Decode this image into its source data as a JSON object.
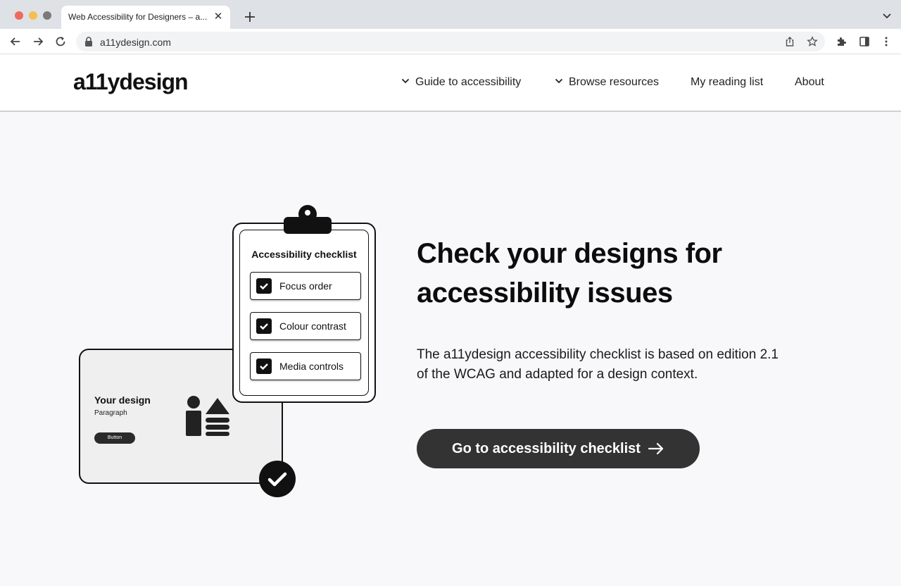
{
  "browser": {
    "tab_title": "Web Accessibility for Designers – a...",
    "url": "a11ydesign.com"
  },
  "site": {
    "logo": "a11ydesign",
    "nav": [
      {
        "label": "Guide to accessibility",
        "has_dropdown": true
      },
      {
        "label": "Browse resources",
        "has_dropdown": true
      },
      {
        "label": "My reading list",
        "has_dropdown": false
      },
      {
        "label": "About",
        "has_dropdown": false
      }
    ]
  },
  "hero": {
    "headline_line1": "Check your designs for",
    "headline_line2": "accessibility issues",
    "body_line1": "The a11ydesign accessibility checklist is based on edition 2.1",
    "body_line2": "of the WCAG and adapted for a design context.",
    "cta_label": "Go to accessibility checklist"
  },
  "illustration": {
    "design_card": {
      "title": "Your design",
      "paragraph": "Paragraph",
      "button": "Button"
    },
    "checklist": {
      "title": "Accessibility checklist",
      "items": [
        "Focus order",
        "Colour contrast",
        "Media controls"
      ]
    }
  },
  "colors": {
    "cta_background": "#333333",
    "page_background": "#f8f8fb",
    "ink": "#111111"
  }
}
